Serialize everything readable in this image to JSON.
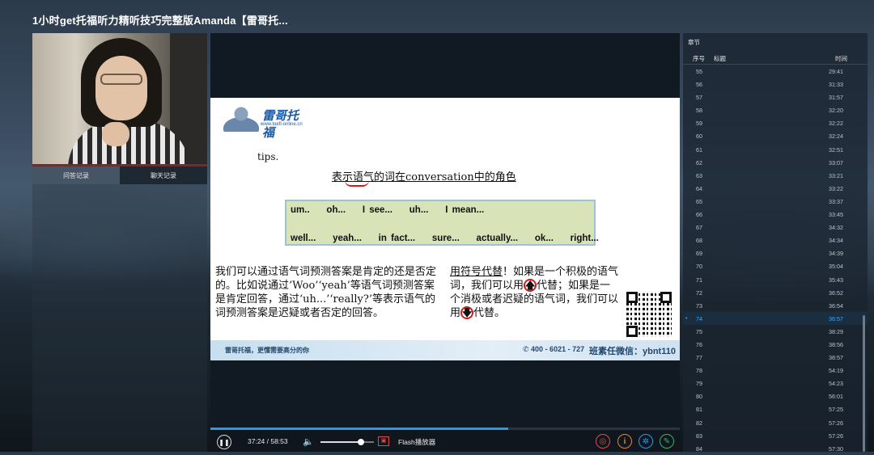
{
  "window": {
    "title": "1小时get托福听力精听技巧完整版Amanda【雷哥托..."
  },
  "left_panel": {
    "tabs": [
      {
        "label": "问答记录",
        "active": true
      },
      {
        "label": "聊天记录",
        "active": false
      }
    ]
  },
  "slide": {
    "logo_text": "雷哥托福",
    "logo_url": "www.toefl-online.cn",
    "tips": "tips.",
    "heading": "表示语气的词在conversation中的角色",
    "phrases_row1": "um..    oh...    I see...    uh...    I mean...",
    "phrases_row2": "well...    yeah...    in fact...    sure...    actually...    ok...    right...",
    "left_paragraph": "我们可以通过语气词预测答案是肯定的还是否定的。比如说通过‘Woo’‘yeah’等语气词预测答案是肯定回答，通过‘uh...’‘really?’等表示语气的词预测答案是迟疑或者否定的回答。",
    "right_underlined": "用符号代替",
    "right_p1": "！如果是一个积极的语气词，我们可以用",
    "right_up_arrow": "🡅",
    "right_p2": "代替；如果是一个消极或者迟疑的语气词，我们可以用",
    "right_down_arrow": "🡇",
    "right_p3": "代替。",
    "footer_left": "雷哥托福，更懂需要高分的你",
    "footer_phone": "400 - 6021 - 727",
    "footer_wechat": "班素任微信：ybnt110"
  },
  "player": {
    "time": "37:24 / 58:53",
    "progress": 0.635,
    "volume": 0.75,
    "flash_label": "Flash播放器",
    "play_icon": "pause-icon",
    "volume_icon": "volume-icon"
  },
  "sidebar": {
    "title": "章节",
    "col_index": "序号",
    "col_title": "标题",
    "col_time": "时间",
    "rows": [
      {
        "n": "55",
        "t": "29:41"
      },
      {
        "n": "56",
        "t": "31:33"
      },
      {
        "n": "57",
        "t": "31:57"
      },
      {
        "n": "58",
        "t": "32:20"
      },
      {
        "n": "59",
        "t": "32:22"
      },
      {
        "n": "60",
        "t": "32:24"
      },
      {
        "n": "61",
        "t": "32:51"
      },
      {
        "n": "62",
        "t": "33:07"
      },
      {
        "n": "63",
        "t": "33:21"
      },
      {
        "n": "64",
        "t": "33:22"
      },
      {
        "n": "65",
        "t": "33:37"
      },
      {
        "n": "66",
        "t": "33:45"
      },
      {
        "n": "67",
        "t": "34:32"
      },
      {
        "n": "68",
        "t": "34:34"
      },
      {
        "n": "69",
        "t": "34:39"
      },
      {
        "n": "70",
        "t": "35:04"
      },
      {
        "n": "71",
        "t": "35:43"
      },
      {
        "n": "72",
        "t": "36:52"
      },
      {
        "n": "73",
        "t": "36:54"
      },
      {
        "n": "74",
        "t": "36:57",
        "active": true
      },
      {
        "n": "75",
        "t": "38:29"
      },
      {
        "n": "76",
        "t": "38:56"
      },
      {
        "n": "77",
        "t": "38:57"
      },
      {
        "n": "78",
        "t": "54:19"
      },
      {
        "n": "79",
        "t": "54:23"
      },
      {
        "n": "80",
        "t": "56:01"
      },
      {
        "n": "81",
        "t": "57:25"
      },
      {
        "n": "82",
        "t": "57:26"
      },
      {
        "n": "83",
        "t": "57:26"
      },
      {
        "n": "84",
        "t": "57:30"
      }
    ]
  },
  "colors": {
    "accent": "#38a8ff",
    "progress": "#2b9ae6",
    "annotation": "#d21a1a"
  }
}
